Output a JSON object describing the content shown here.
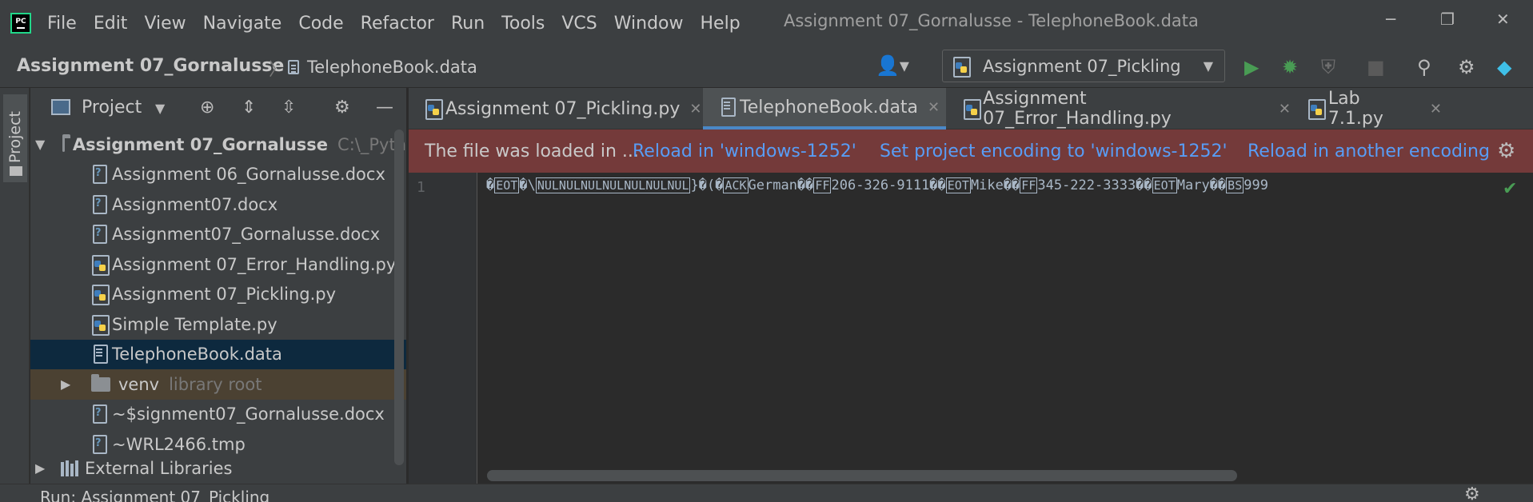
{
  "window": {
    "title": "Assignment 07_Gornalusse - TelephoneBook.data",
    "controls": {
      "minimize": "─",
      "restore": "❐",
      "close": "✕"
    }
  },
  "menu": [
    "File",
    "Edit",
    "View",
    "Navigate",
    "Code",
    "Refactor",
    "Run",
    "Tools",
    "VCS",
    "Window",
    "Help"
  ],
  "app_logo": "PC",
  "breadcrumb": {
    "project": "Assignment 07_Gornalusse",
    "separator": "〉",
    "file": "TelephoneBook.data"
  },
  "run_config": {
    "label": "Assignment 07_Pickling"
  },
  "project_panel": {
    "title": "Project",
    "tree": {
      "root": {
        "name": "Assignment 07_Gornalusse",
        "path": "C:\\_Pyth"
      },
      "files": [
        {
          "name": "Assignment 06_Gornalusse.docx",
          "icon": "unknown-file-icon"
        },
        {
          "name": "Assignment07.docx",
          "icon": "unknown-file-icon"
        },
        {
          "name": "Assignment07_Gornalusse.docx",
          "icon": "unknown-file-icon"
        },
        {
          "name": "Assignment 07_Error_Handling.py",
          "icon": "python-file-icon"
        },
        {
          "name": "Assignment 07_Pickling.py",
          "icon": "python-file-icon"
        },
        {
          "name": "Simple Template.py",
          "icon": "python-file-icon"
        },
        {
          "name": "TelephoneBook.data",
          "icon": "data-file-icon"
        }
      ],
      "venv": {
        "name": "venv",
        "note": "library root"
      },
      "files2": [
        {
          "name": "~$signment07_Gornalusse.docx",
          "icon": "unknown-file-icon"
        },
        {
          "name": "~WRL2466.tmp",
          "icon": "unknown-file-icon"
        }
      ],
      "external": "External Libraries"
    }
  },
  "editor": {
    "tabs": [
      {
        "label": "Assignment 07_Pickling.py",
        "active": false
      },
      {
        "label": "TelephoneBook.data",
        "active": true
      },
      {
        "label": "Assignment 07_Error_Handling.py",
        "active": false
      },
      {
        "label": "Lab 7.1.py",
        "active": false
      }
    ],
    "banner": {
      "message": "The file was loaded in ...",
      "link1": "Reload in 'windows-1252'",
      "link2": "Set project encoding to 'windows-1252'",
      "link3": "Reload in another encoding"
    },
    "line_number": "1",
    "code": {
      "t1": "�",
      "c1": "EOT",
      "t2": "�\\",
      "c2": "NULNULNULNULNULNULNUL",
      "t3": "}�(�",
      "c3": "ACK",
      "t4": "German��",
      "c4": "FF",
      "t5": "206-326-9111��",
      "c5": "EOT",
      "t6": "Mike��",
      "c6": "FF",
      "t7": "345-222-3333��",
      "c7": "EOT",
      "t8": "Mary��",
      "c8": "BS",
      "t9": "999"
    }
  },
  "bottom": {
    "run_label": "Run:  Assignment 07_Pickling"
  },
  "colors": {
    "accent": "#4a88c7",
    "banner": "#743a3a",
    "link": "#589df6",
    "run": "#499c54",
    "selected": "#0d293e"
  }
}
